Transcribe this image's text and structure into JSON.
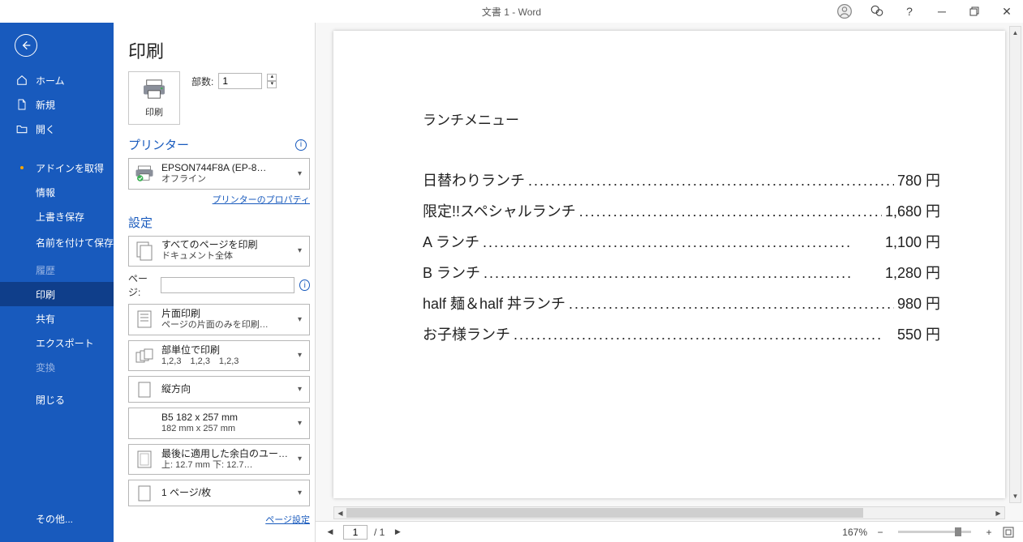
{
  "title": "文書 1  -  Word",
  "sidebar": {
    "home": "ホーム",
    "new": "新規",
    "open": "開く",
    "addin": "アドインを取得",
    "info": "情報",
    "save": "上書き保存",
    "saveas": "名前を付けて保存",
    "history": "履歴",
    "print": "印刷",
    "share": "共有",
    "export": "エクスポート",
    "transform": "変換",
    "close": "閉じる",
    "other": "その他..."
  },
  "heading": "印刷",
  "printBtn": "印刷",
  "copiesLabel": "部数:",
  "copiesValue": "1",
  "printerHdr": "プリンター",
  "printer": {
    "name": "EPSON744F8A (EP-8…",
    "status": "オフライン"
  },
  "printerProps": "プリンターのプロパティ",
  "settingsHdr": "設定",
  "dd": {
    "scope": {
      "l1": "すべてのページを印刷",
      "l2": "ドキュメント全体"
    },
    "pagesLabel": "ページ:",
    "side": {
      "l1": "片面印刷",
      "l2": "ページの片面のみを印刷…"
    },
    "collate": {
      "l1": "部単位で印刷",
      "l2": "1,2,3　1,2,3　1,2,3"
    },
    "orient": {
      "l1": "縦方向"
    },
    "paper": {
      "l1": "B5 182 x 257 mm",
      "l2": "182 mm x 257 mm"
    },
    "margin": {
      "l1": "最後に適用した余白のユー…",
      "l2": "上: 12.7 mm 下: 12.7…"
    },
    "sheet": {
      "l1": "1 ページ/枚"
    }
  },
  "pageSetup": "ページ設定",
  "doc": {
    "title": "ランチメニュー",
    "items": [
      {
        "name": "日替わりランチ",
        "price": "780 円"
      },
      {
        "name": "限定!!スペシャルランチ",
        "price": "1,680 円"
      },
      {
        "name": "A ランチ",
        "price": "1,100 円"
      },
      {
        "name": "B ランチ",
        "price": "1,280 円"
      },
      {
        "name": "half 麺＆half 丼ランチ",
        "price": "980 円"
      },
      {
        "name": "お子様ランチ",
        "price": "550 円"
      }
    ]
  },
  "status": {
    "page": "1",
    "total": "/ 1",
    "zoom": "167%"
  }
}
